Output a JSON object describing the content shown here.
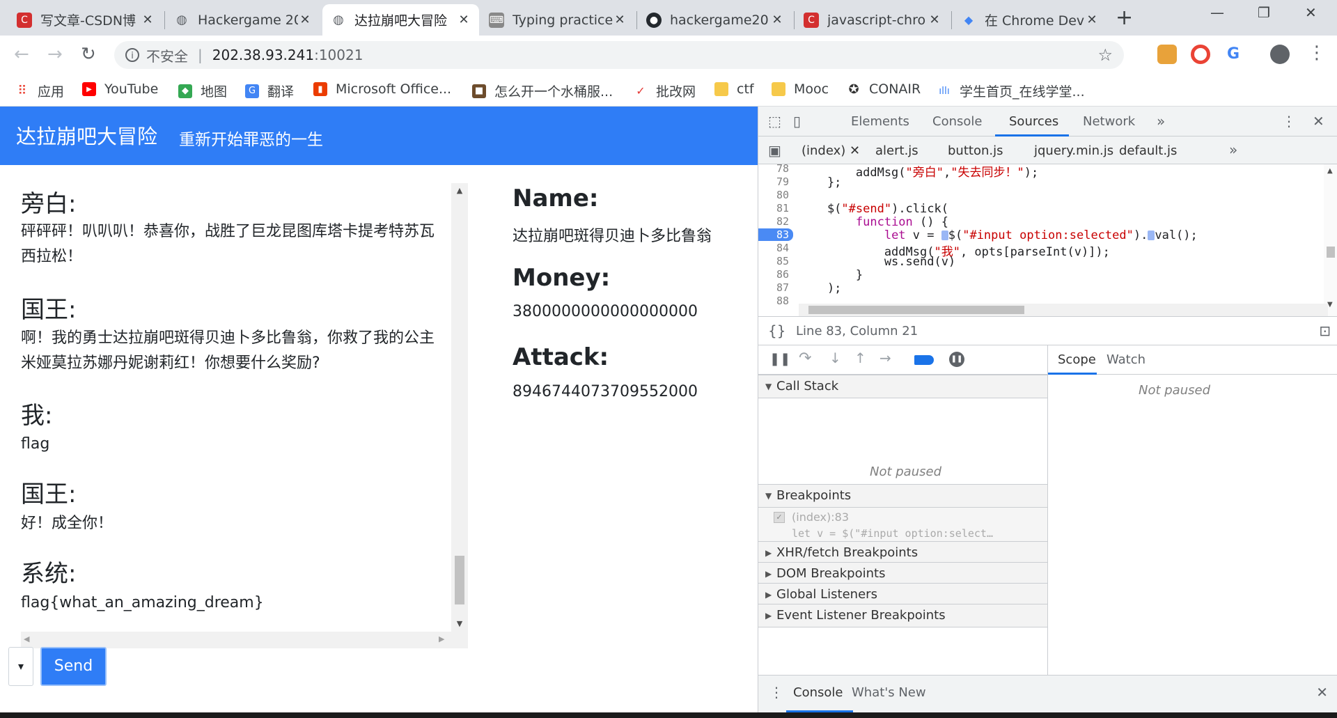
{
  "tabs": [
    {
      "title": "写文章-CSDN博",
      "icon": "csdn-icon",
      "color": "#d32f2f"
    },
    {
      "title": "Hackergame 20",
      "icon": "globe-icon",
      "color": "#5f6368"
    },
    {
      "title": "达拉崩吧大冒险",
      "icon": "globe-icon",
      "color": "#5f6368"
    },
    {
      "title": "Typing practice",
      "icon": "typing-icon",
      "color": "#777777"
    },
    {
      "title": "hackergame20",
      "icon": "github-icon",
      "color": "#24292e"
    },
    {
      "title": "javascript-chro",
      "icon": "csdn-icon",
      "color": "#d32f2f"
    },
    {
      "title": "在 Chrome Dev",
      "icon": "chrome-dev-icon",
      "color": "#4285f4"
    }
  ],
  "address": {
    "insecure_label": "不安全",
    "host": "202.38.93.241",
    "port": ":10021"
  },
  "bookmarks": [
    {
      "label": "应用",
      "icon": "apps-icon"
    },
    {
      "label": "YouTube",
      "icon": "youtube-icon"
    },
    {
      "label": "地图",
      "icon": "maps-icon"
    },
    {
      "label": "翻译",
      "icon": "translate-icon"
    },
    {
      "label": "Microsoft Office...",
      "icon": "office-icon"
    },
    {
      "label": "怎么开一个水桶服...",
      "icon": "minecraft-icon"
    },
    {
      "label": "批改网",
      "icon": "pigai-icon"
    },
    {
      "label": "ctf",
      "icon": "folder-icon"
    },
    {
      "label": "Mooc",
      "icon": "folder-icon"
    },
    {
      "label": "CONAIR",
      "icon": "conair-icon"
    },
    {
      "label": "学生首页_在线学堂...",
      "icon": "xuetang-icon"
    }
  ],
  "page": {
    "brand": "达拉崩吧大冒险",
    "subtitle": "重新开始罪恶的一生",
    "messages": [
      {
        "speaker": "旁白:",
        "text": "砰砰砰！叭叭叭！恭喜你，战胜了巨龙昆图库塔卡提考特苏瓦西拉松！"
      },
      {
        "speaker": "国王:",
        "text": "啊！我的勇士达拉崩吧斑得贝迪卜多比鲁翁，你救了我的公主米娅莫拉苏娜丹妮谢莉红！你想要什么奖励?"
      },
      {
        "speaker": "我:",
        "text": "flag"
      },
      {
        "speaker": "国王:",
        "text": "好！成全你！"
      },
      {
        "speaker": "系统:",
        "text": "flag{what_an_amazing_dream}"
      }
    ],
    "stats": {
      "name_label": "Name:",
      "name_value": "达拉崩吧斑得贝迪卜多比鲁翁",
      "money_label": "Money:",
      "money_value": "3800000000000000000",
      "attack_label": "Attack:",
      "attack_value": "8946744073709552000"
    },
    "select_value": "",
    "send_label": "Send"
  },
  "devtools": {
    "tabs": [
      "Elements",
      "Console",
      "Sources",
      "Network"
    ],
    "active_tab": "Sources",
    "files": [
      "(index)",
      "alert.js",
      "button.js",
      "jquery.min.js",
      "default.js"
    ],
    "code_lines": [
      {
        "n": "78",
        "code": "        addMsg(\"旁白\",\"失去同步！\");"
      },
      {
        "n": "79",
        "code": "    };"
      },
      {
        "n": "80",
        "code": ""
      },
      {
        "n": "81",
        "code": "    $(\"#send\").click("
      },
      {
        "n": "82",
        "code": "        function () {"
      },
      {
        "n": "83",
        "code": "            let v = $(\"#input option:selected\").val();",
        "breakpoint": true
      },
      {
        "n": "84",
        "code": "            addMsg(\"我\", opts[parseInt(v)]);"
      },
      {
        "n": "85",
        "code": "            ws.send(v)"
      },
      {
        "n": "86",
        "code": "        }"
      },
      {
        "n": "87",
        "code": "    );"
      },
      {
        "n": "88",
        "code": ""
      }
    ],
    "status_text": "Line 83, Column 21",
    "call_stack_label": "Call Stack",
    "not_paused": "Not paused",
    "breakpoints_label": "Breakpoints",
    "breakpoint_item": {
      "location": "(index):83",
      "snippet": "let v = $(\"#input option:select…"
    },
    "sections": [
      "XHR/fetch Breakpoints",
      "DOM Breakpoints",
      "Global Listeners",
      "Event Listener Breakpoints"
    ],
    "right_tabs": [
      "Scope",
      "Watch"
    ],
    "drawer_tabs": [
      "Console",
      "What's New"
    ]
  },
  "colors": {
    "accent": "#2f7df6",
    "devtools_blue": "#1a73e8"
  }
}
